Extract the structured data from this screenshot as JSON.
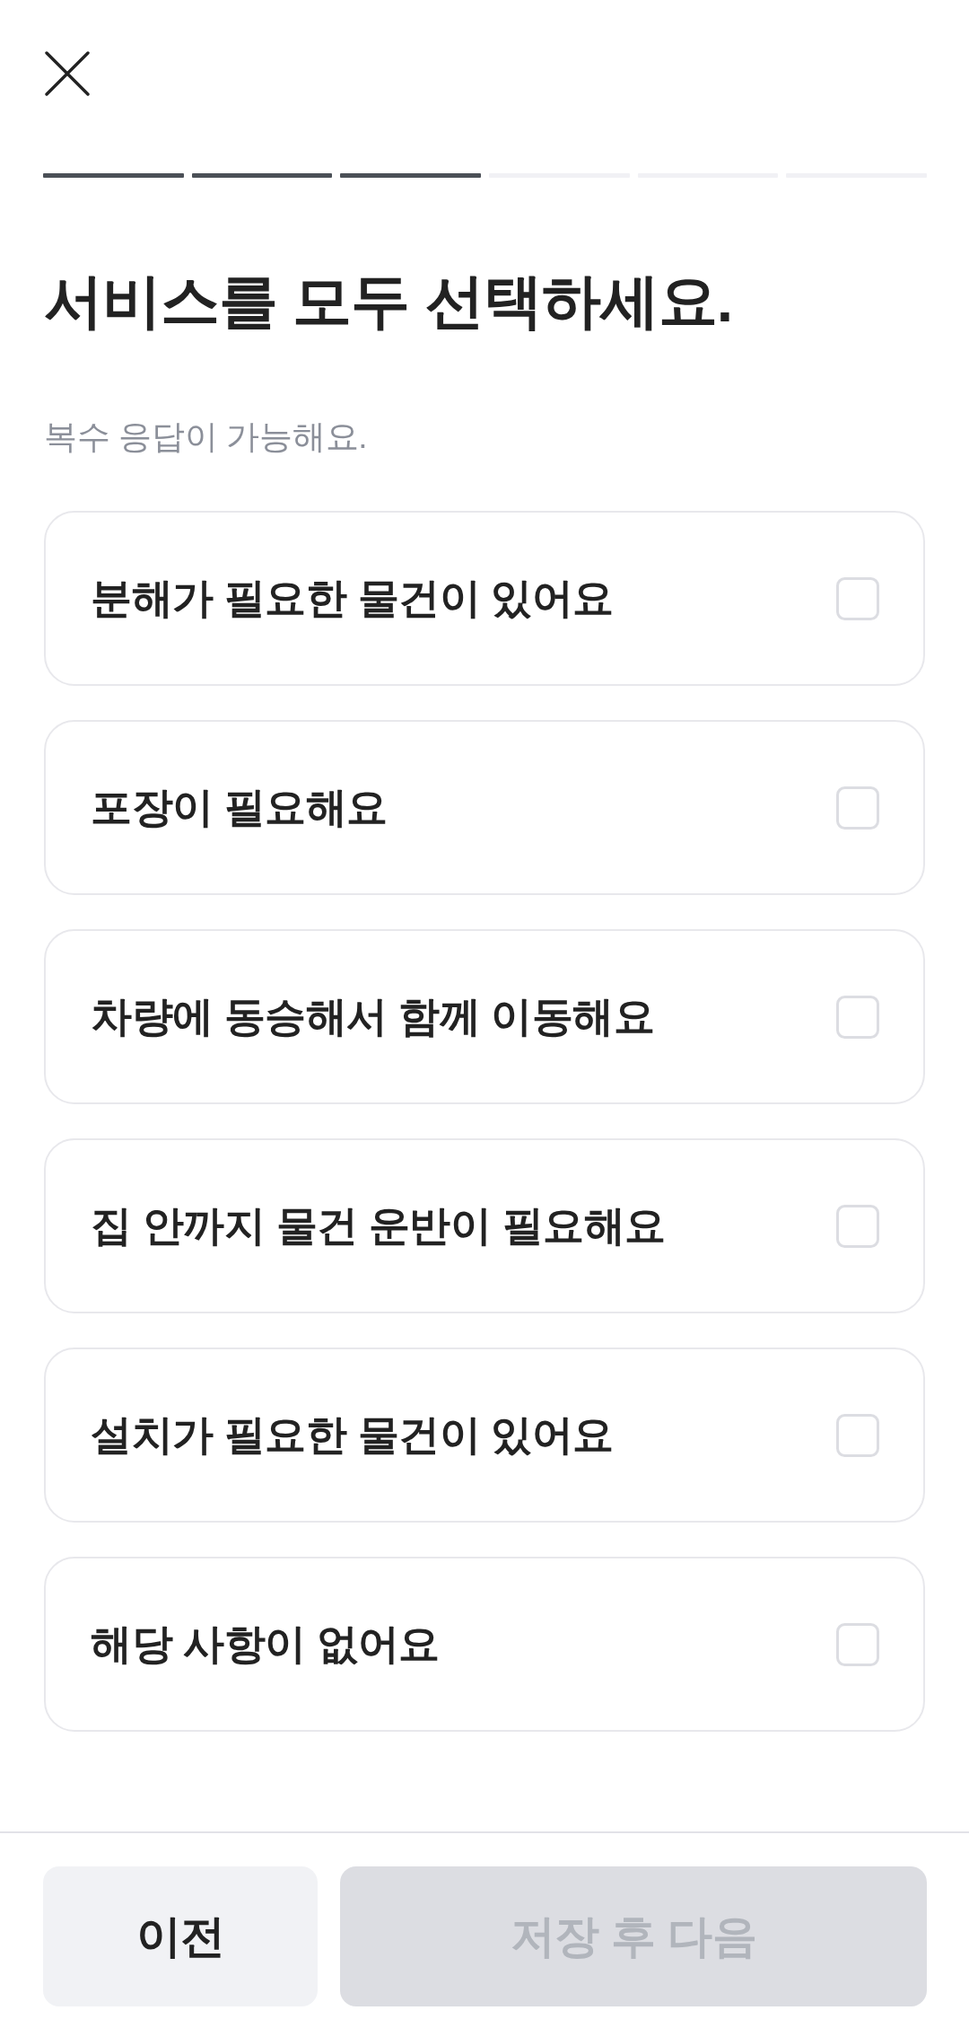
{
  "progress": {
    "steps": [
      {
        "completed": true
      },
      {
        "completed": true
      },
      {
        "completed": true
      },
      {
        "completed": false
      },
      {
        "completed": false
      },
      {
        "completed": false
      }
    ]
  },
  "title": "서비스를 모두 선택하세요.",
  "hint": "복수 응답이 가능해요.",
  "options": [
    {
      "label": "분해가 필요한 물건이 있어요",
      "checked": false
    },
    {
      "label": "포장이 필요해요",
      "checked": false
    },
    {
      "label": "차량에 동승해서 함께 이동해요",
      "checked": false
    },
    {
      "label": "집 안까지 물건 운반이 필요해요",
      "checked": false
    },
    {
      "label": "설치가 필요한 물건이 있어요",
      "checked": false
    },
    {
      "label": "해당 사항이 없어요",
      "checked": false
    }
  ],
  "footer": {
    "buttons": [
      {
        "label": "이전",
        "kind": "secondary",
        "disabled": false
      },
      {
        "label": "저장 후 다음",
        "kind": "primary",
        "disabled": true
      }
    ]
  }
}
